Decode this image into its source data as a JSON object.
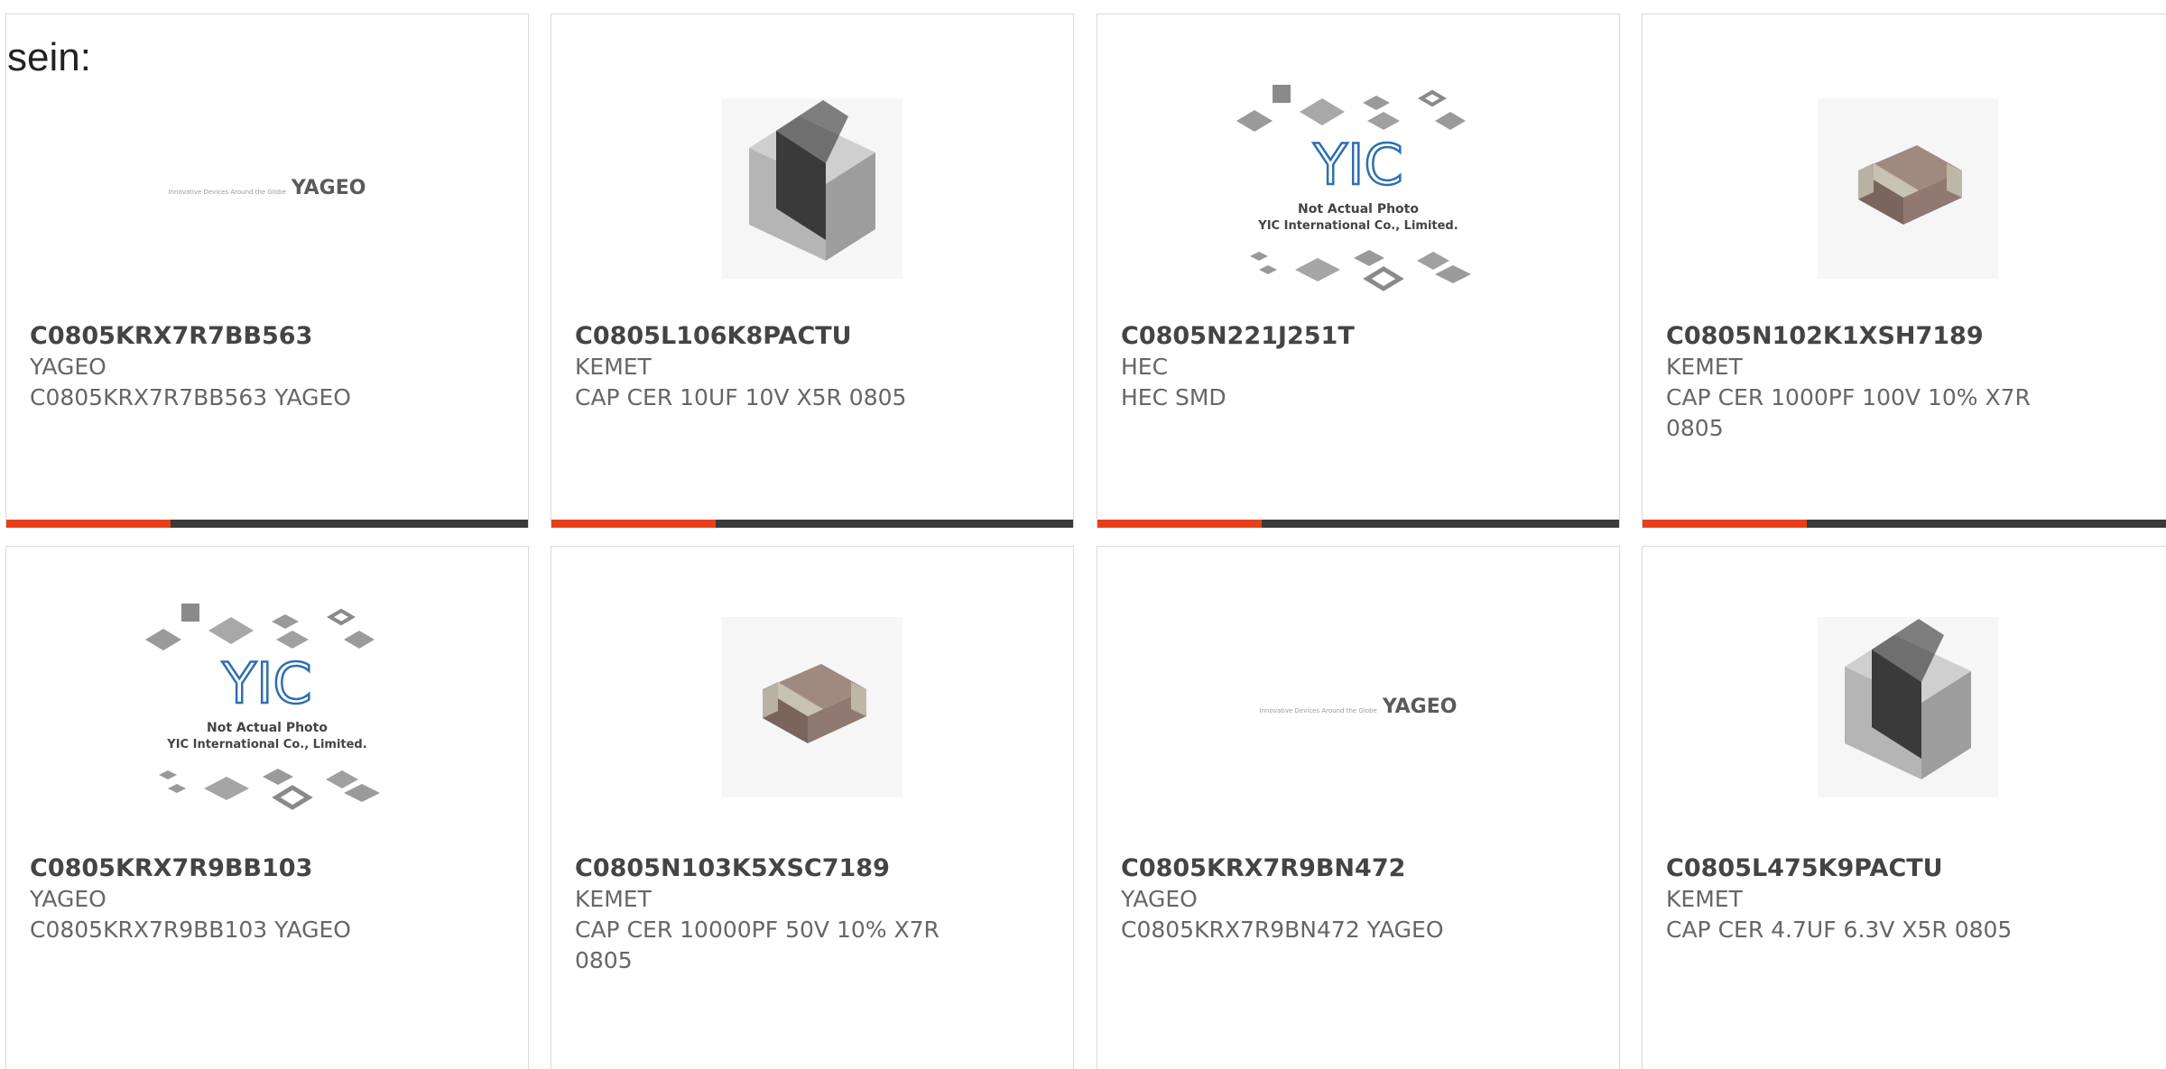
{
  "heading": "sein:",
  "cards": [
    {
      "part_number": "C0805KRX7R7BB563",
      "manufacturer": "YAGEO",
      "description": "C0805KRX7R7BB563 YAGEO",
      "image": "yageo-logo"
    },
    {
      "part_number": "C0805L106K8PACTU",
      "manufacturer": "KEMET",
      "description": "CAP CER 10UF 10V X5R 0805",
      "image": "gray-chip"
    },
    {
      "part_number": "C0805N221J251T",
      "manufacturer": "HEC",
      "description": "HEC SMD",
      "image": "yic-placeholder"
    },
    {
      "part_number": "C0805N102K1XSH7189",
      "manufacturer": "KEMET",
      "description": "CAP CER 1000PF 100V 10% X7R 0805",
      "image": "brown-chip"
    },
    {
      "part_number": "C0805KRX7R9BB103",
      "manufacturer": "YAGEO",
      "description": "C0805KRX7R9BB103 YAGEO",
      "image": "yic-placeholder"
    },
    {
      "part_number": "C0805N103K5XSC7189",
      "manufacturer": "KEMET",
      "description": "CAP CER 10000PF 50V 10% X7R 0805",
      "image": "brown-chip"
    },
    {
      "part_number": "C0805KRX7R9BN472",
      "manufacturer": "YAGEO",
      "description": "C0805KRX7R9BN472 YAGEO",
      "image": "yageo-logo"
    },
    {
      "part_number": "C0805L475K9PACTU",
      "manufacturer": "KEMET",
      "description": "CAP CER 4.7UF 6.3V X5R 0805",
      "image": "gray-chip"
    }
  ],
  "images": {
    "yageo_tagline": "Innovative Devices Around the Globe",
    "yageo_word": "YAGEO",
    "yic_logo": "YIC",
    "yic_line1": "Not Actual Photo",
    "yic_line2": "YIC International Co., Limited."
  },
  "colors": {
    "accent": "#e8401a",
    "bar": "#3a3a3a",
    "border": "#d9d9d9"
  }
}
